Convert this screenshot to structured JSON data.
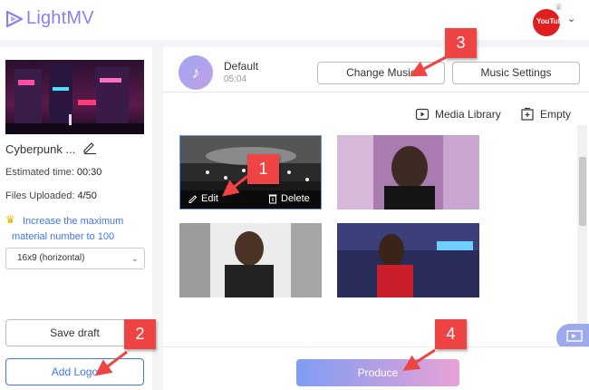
{
  "app": {
    "name": "LightMV"
  },
  "header": {
    "avatar_text": "YouTube"
  },
  "project": {
    "name": "Cyberpunk ...",
    "estimated_time_label": "Estimated time:",
    "estimated_time": "00:30",
    "files_uploaded_label": "Files Uploaded:",
    "files_uploaded": "4/50",
    "upgrade_line1": "Increase the maximum",
    "upgrade_line2": "material number to 100",
    "ratio": "16x9 (horizontal)",
    "save_draft": "Save draft",
    "add_logo": "Add Logo"
  },
  "music": {
    "title": "Default",
    "duration": "05:04",
    "change_music": "Change Music",
    "music_settings": "Music Settings"
  },
  "library": {
    "media_library": "Media Library",
    "empty": "Empty"
  },
  "tile_actions": {
    "edit": "Edit",
    "delete": "Delete"
  },
  "produce": "Produce",
  "annotations": [
    "1",
    "2",
    "3",
    "4"
  ],
  "colors": {
    "accent": "#8b7ff0",
    "link": "#3d77e8",
    "annotation": "#ef4444"
  }
}
